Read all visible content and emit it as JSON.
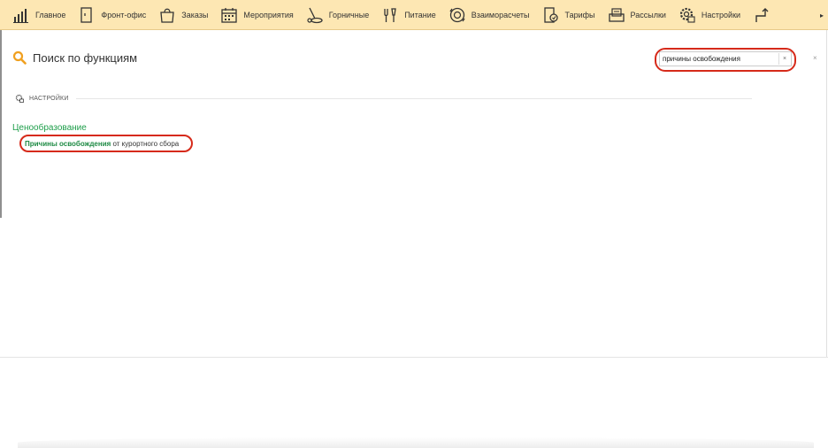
{
  "nav": {
    "items": [
      {
        "label": "Главное",
        "icon": "bar-chart-icon"
      },
      {
        "label": "Фронт-офис",
        "icon": "door-icon"
      },
      {
        "label": "Заказы",
        "icon": "bag-icon"
      },
      {
        "label": "Мероприятия",
        "icon": "calendar-icon"
      },
      {
        "label": "Горничные",
        "icon": "vacuum-icon"
      },
      {
        "label": "Питание",
        "icon": "food-icon"
      },
      {
        "label": "Взаиморасчеты",
        "icon": "settlement-icon"
      },
      {
        "label": "Тарифы",
        "icon": "tariff-icon"
      },
      {
        "label": "Рассылки",
        "icon": "mail-icon"
      },
      {
        "label": "Настройки",
        "icon": "gear-icon"
      },
      {
        "label": "",
        "icon": "route-icon"
      }
    ],
    "more": "▸"
  },
  "search": {
    "title": "Поиск по функциям",
    "value": "причины освобождения",
    "clear": "×",
    "close": "×"
  },
  "section": {
    "label": "НАСТРОЙКИ"
  },
  "group": {
    "title": "Ценообразование",
    "result_highlight": "Причины освобождения",
    "result_rest": " от курортного сбора"
  },
  "colors": {
    "nav_bg": "#fde7b3",
    "accent_green": "#1e9e4a",
    "highlight_red": "#d62a1a",
    "search_icon": "#f0a020"
  }
}
